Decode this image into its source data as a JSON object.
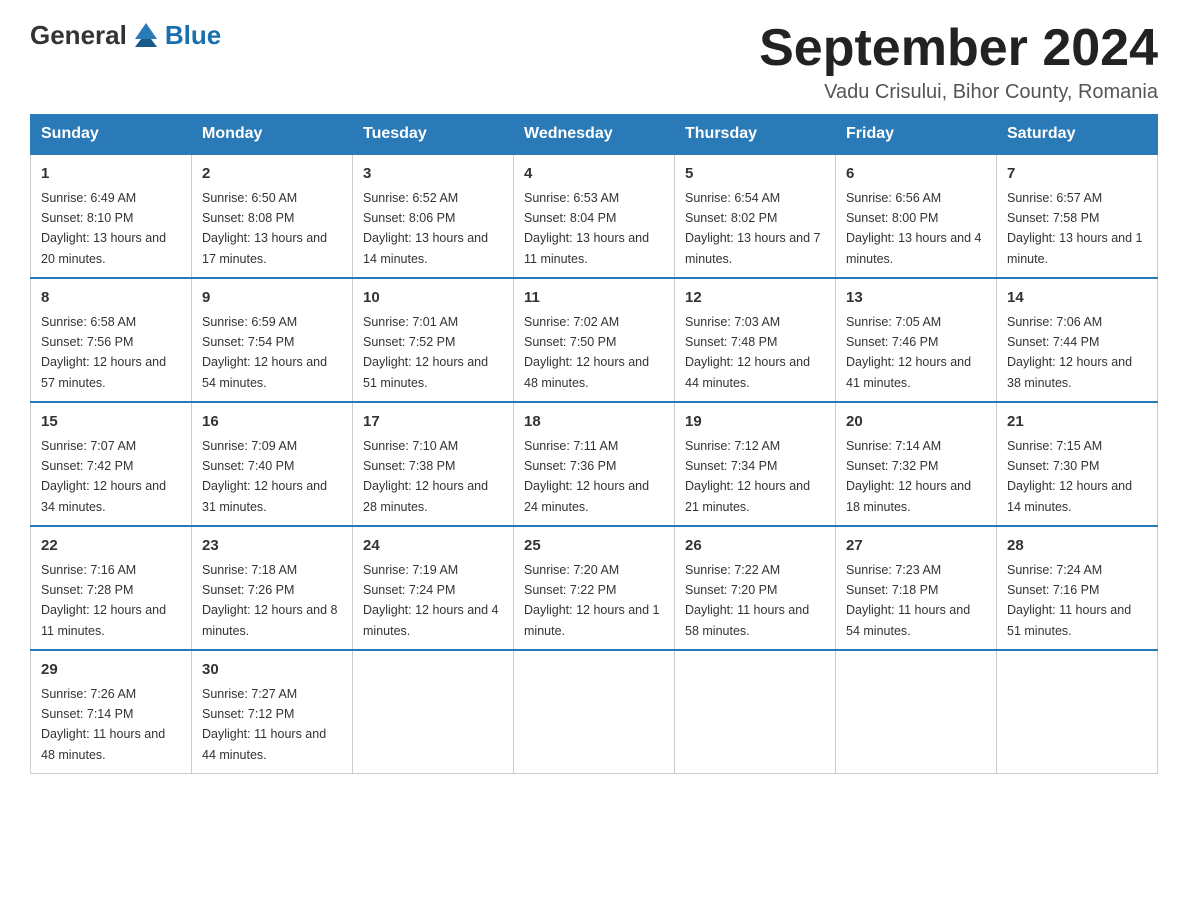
{
  "logo": {
    "general": "General",
    "blue": "Blue"
  },
  "title": "September 2024",
  "location": "Vadu Crisului, Bihor County, Romania",
  "days_header": [
    "Sunday",
    "Monday",
    "Tuesday",
    "Wednesday",
    "Thursday",
    "Friday",
    "Saturday"
  ],
  "weeks": [
    [
      {
        "day": "1",
        "sunrise": "6:49 AM",
        "sunset": "8:10 PM",
        "daylight": "13 hours and 20 minutes."
      },
      {
        "day": "2",
        "sunrise": "6:50 AM",
        "sunset": "8:08 PM",
        "daylight": "13 hours and 17 minutes."
      },
      {
        "day": "3",
        "sunrise": "6:52 AM",
        "sunset": "8:06 PM",
        "daylight": "13 hours and 14 minutes."
      },
      {
        "day": "4",
        "sunrise": "6:53 AM",
        "sunset": "8:04 PM",
        "daylight": "13 hours and 11 minutes."
      },
      {
        "day": "5",
        "sunrise": "6:54 AM",
        "sunset": "8:02 PM",
        "daylight": "13 hours and 7 minutes."
      },
      {
        "day": "6",
        "sunrise": "6:56 AM",
        "sunset": "8:00 PM",
        "daylight": "13 hours and 4 minutes."
      },
      {
        "day": "7",
        "sunrise": "6:57 AM",
        "sunset": "7:58 PM",
        "daylight": "13 hours and 1 minute."
      }
    ],
    [
      {
        "day": "8",
        "sunrise": "6:58 AM",
        "sunset": "7:56 PM",
        "daylight": "12 hours and 57 minutes."
      },
      {
        "day": "9",
        "sunrise": "6:59 AM",
        "sunset": "7:54 PM",
        "daylight": "12 hours and 54 minutes."
      },
      {
        "day": "10",
        "sunrise": "7:01 AM",
        "sunset": "7:52 PM",
        "daylight": "12 hours and 51 minutes."
      },
      {
        "day": "11",
        "sunrise": "7:02 AM",
        "sunset": "7:50 PM",
        "daylight": "12 hours and 48 minutes."
      },
      {
        "day": "12",
        "sunrise": "7:03 AM",
        "sunset": "7:48 PM",
        "daylight": "12 hours and 44 minutes."
      },
      {
        "day": "13",
        "sunrise": "7:05 AM",
        "sunset": "7:46 PM",
        "daylight": "12 hours and 41 minutes."
      },
      {
        "day": "14",
        "sunrise": "7:06 AM",
        "sunset": "7:44 PM",
        "daylight": "12 hours and 38 minutes."
      }
    ],
    [
      {
        "day": "15",
        "sunrise": "7:07 AM",
        "sunset": "7:42 PM",
        "daylight": "12 hours and 34 minutes."
      },
      {
        "day": "16",
        "sunrise": "7:09 AM",
        "sunset": "7:40 PM",
        "daylight": "12 hours and 31 minutes."
      },
      {
        "day": "17",
        "sunrise": "7:10 AM",
        "sunset": "7:38 PM",
        "daylight": "12 hours and 28 minutes."
      },
      {
        "day": "18",
        "sunrise": "7:11 AM",
        "sunset": "7:36 PM",
        "daylight": "12 hours and 24 minutes."
      },
      {
        "day": "19",
        "sunrise": "7:12 AM",
        "sunset": "7:34 PM",
        "daylight": "12 hours and 21 minutes."
      },
      {
        "day": "20",
        "sunrise": "7:14 AM",
        "sunset": "7:32 PM",
        "daylight": "12 hours and 18 minutes."
      },
      {
        "day": "21",
        "sunrise": "7:15 AM",
        "sunset": "7:30 PM",
        "daylight": "12 hours and 14 minutes."
      }
    ],
    [
      {
        "day": "22",
        "sunrise": "7:16 AM",
        "sunset": "7:28 PM",
        "daylight": "12 hours and 11 minutes."
      },
      {
        "day": "23",
        "sunrise": "7:18 AM",
        "sunset": "7:26 PM",
        "daylight": "12 hours and 8 minutes."
      },
      {
        "day": "24",
        "sunrise": "7:19 AM",
        "sunset": "7:24 PM",
        "daylight": "12 hours and 4 minutes."
      },
      {
        "day": "25",
        "sunrise": "7:20 AM",
        "sunset": "7:22 PM",
        "daylight": "12 hours and 1 minute."
      },
      {
        "day": "26",
        "sunrise": "7:22 AM",
        "sunset": "7:20 PM",
        "daylight": "11 hours and 58 minutes."
      },
      {
        "day": "27",
        "sunrise": "7:23 AM",
        "sunset": "7:18 PM",
        "daylight": "11 hours and 54 minutes."
      },
      {
        "day": "28",
        "sunrise": "7:24 AM",
        "sunset": "7:16 PM",
        "daylight": "11 hours and 51 minutes."
      }
    ],
    [
      {
        "day": "29",
        "sunrise": "7:26 AM",
        "sunset": "7:14 PM",
        "daylight": "11 hours and 48 minutes."
      },
      {
        "day": "30",
        "sunrise": "7:27 AM",
        "sunset": "7:12 PM",
        "daylight": "11 hours and 44 minutes."
      },
      null,
      null,
      null,
      null,
      null
    ]
  ],
  "labels": {
    "sunrise": "Sunrise:",
    "sunset": "Sunset:",
    "daylight": "Daylight:"
  }
}
